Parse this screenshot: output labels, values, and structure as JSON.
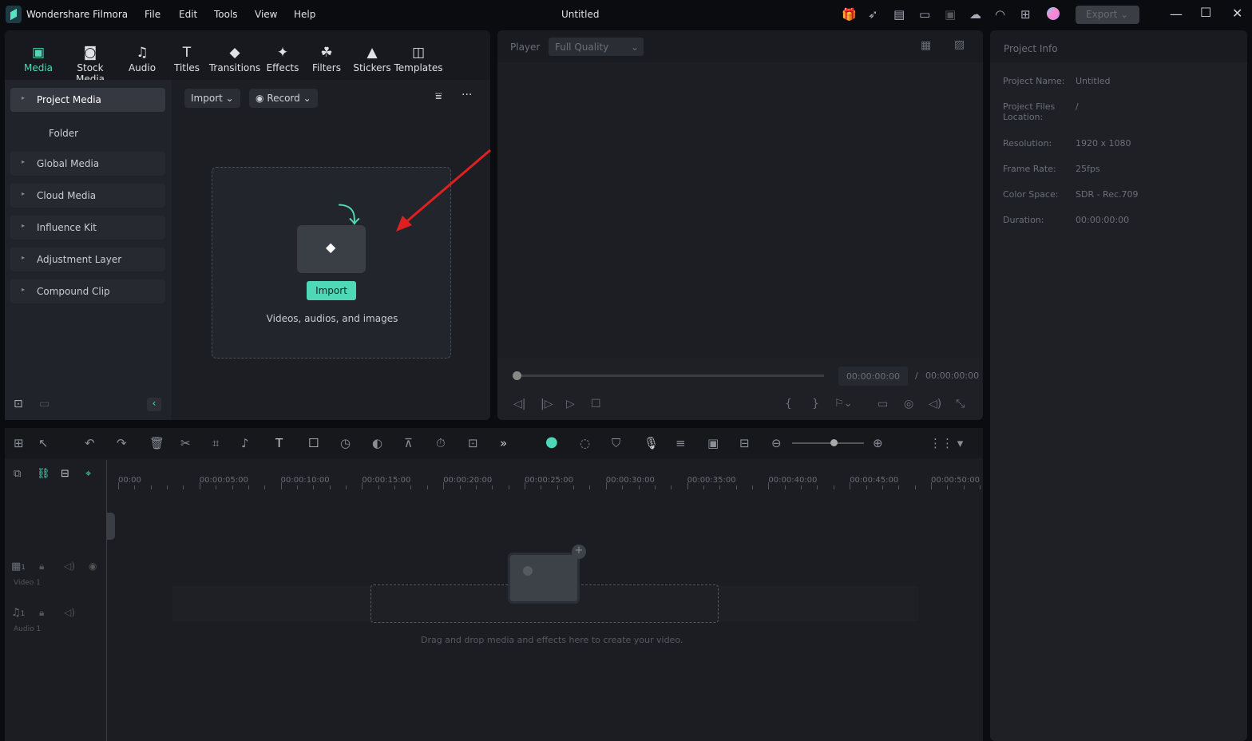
{
  "app": {
    "name": "Wondershare Filmora",
    "title": "Untitled",
    "export_label": "Export"
  },
  "menu": [
    "File",
    "Edit",
    "Tools",
    "View",
    "Help"
  ],
  "tabs": [
    {
      "label": "Media",
      "icon": "media-icon",
      "active": true
    },
    {
      "label": "Stock Media",
      "icon": "stock-media-icon"
    },
    {
      "label": "Audio",
      "icon": "music-note-icon"
    },
    {
      "label": "Titles",
      "icon": "text-icon"
    },
    {
      "label": "Transitions",
      "icon": "transitions-icon"
    },
    {
      "label": "Effects",
      "icon": "effects-icon"
    },
    {
      "label": "Filters",
      "icon": "filters-icon"
    },
    {
      "label": "Stickers",
      "icon": "stickers-icon"
    },
    {
      "label": "Templates",
      "icon": "templates-icon"
    }
  ],
  "sidebar": {
    "items": [
      {
        "label": "Project Media",
        "expanded": true
      },
      {
        "label": "Folder"
      },
      {
        "label": "Global Media"
      },
      {
        "label": "Cloud Media"
      },
      {
        "label": "Influence Kit"
      },
      {
        "label": "Adjustment Layer"
      },
      {
        "label": "Compound Clip"
      }
    ]
  },
  "media": {
    "import_label": "Import",
    "record_label": "Record",
    "drop_button": "Import",
    "drop_hint": "Videos, audios, and images"
  },
  "player": {
    "label": "Player",
    "quality": "Full Quality",
    "current_time": "00:00:00:00",
    "separator": "/",
    "total_time": "00:00:00:00",
    "progress": 0
  },
  "project_info": {
    "title": "Project Info",
    "rows": [
      {
        "label": "Project Name:",
        "value": "Untitled"
      },
      {
        "label": "Project Files Location:",
        "value": "/"
      },
      {
        "label": "Resolution:",
        "value": "1920 x 1080"
      },
      {
        "label": "Frame Rate:",
        "value": "25fps"
      },
      {
        "label": "Color Space:",
        "value": "SDR - Rec.709"
      },
      {
        "label": "Duration:",
        "value": "00:00:00:00"
      }
    ]
  },
  "timeline": {
    "ruler": [
      "00:00",
      "00:00:05:00",
      "00:00:10:00",
      "00:00:15:00",
      "00:00:20:00",
      "00:00:25:00",
      "00:00:30:00",
      "00:00:35:00",
      "00:00:40:00",
      "00:00:45:00",
      "00:00:50:00"
    ],
    "tracks": [
      {
        "label": "Video 1",
        "num": "1"
      },
      {
        "label": "Audio 1",
        "num": "1"
      }
    ],
    "empty_hint": "Drag and drop media and effects here to create your video."
  },
  "colors": {
    "accent": "#4fd8b8",
    "bg": "#0b0c0f",
    "panel": "#1e2026",
    "arrow": "#e02020"
  }
}
